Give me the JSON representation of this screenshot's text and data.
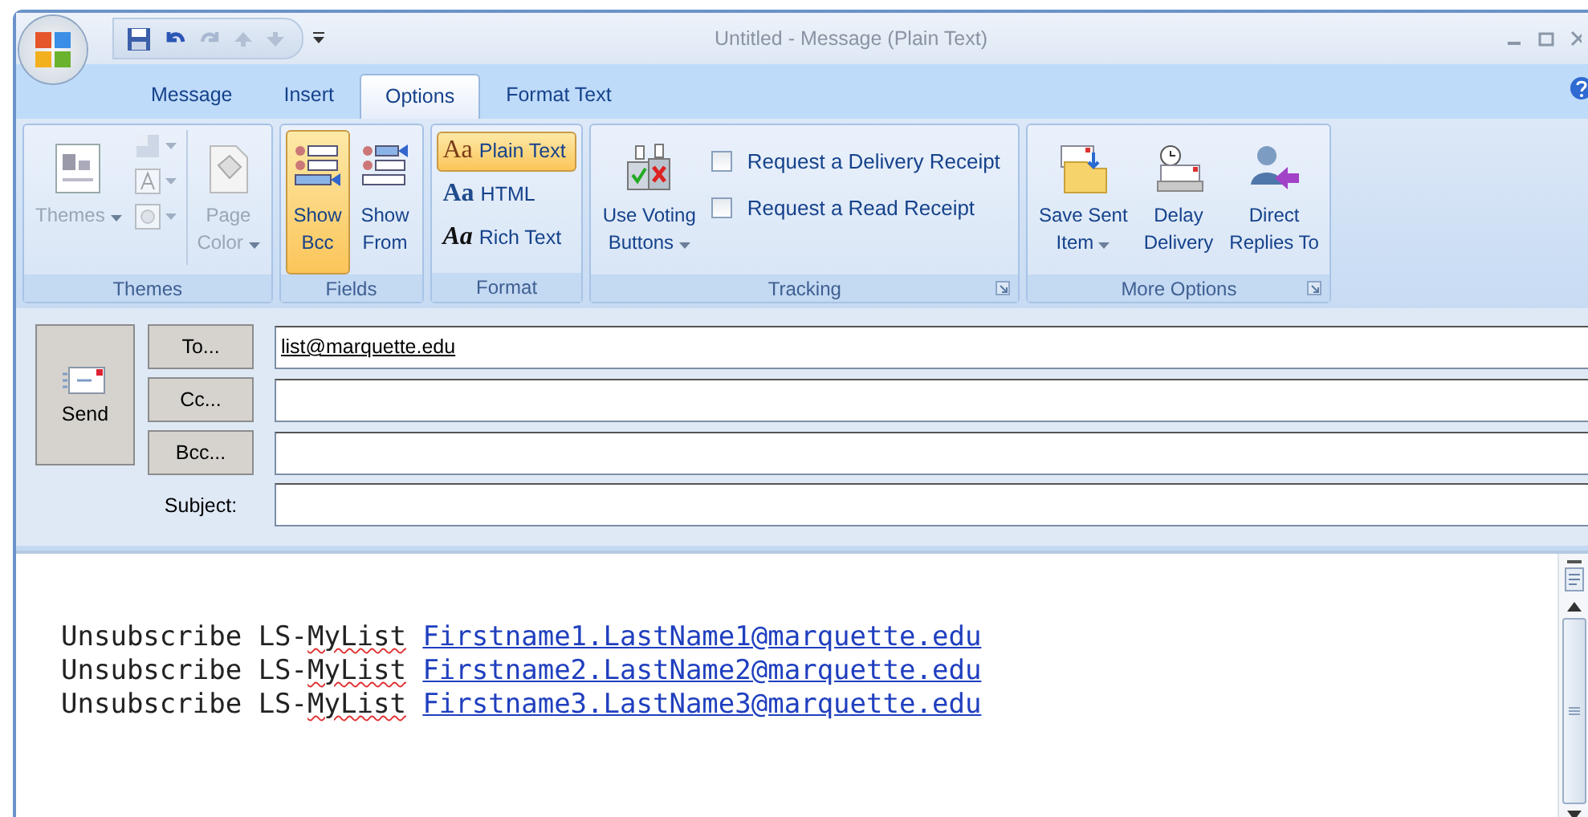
{
  "window": {
    "title": "Untitled - Message (Plain Text)"
  },
  "tabs": [
    {
      "label": "Message",
      "selected": false
    },
    {
      "label": "Insert",
      "selected": false
    },
    {
      "label": "Options",
      "selected": true
    },
    {
      "label": "Format Text",
      "selected": false
    }
  ],
  "ribbon": {
    "groups": [
      {
        "title": "Themes",
        "items": [
          {
            "kind": "large",
            "lines": [
              "Themes"
            ],
            "dropdown": true,
            "disabled": true
          },
          {
            "kind": "stack",
            "children": [
              {
                "dropdown": true,
                "disabled": true
              },
              {
                "dropdown": true,
                "disabled": true
              },
              {
                "dropdown": true,
                "disabled": true
              }
            ]
          },
          {
            "kind": "large",
            "lines": [
              "Page",
              "Color"
            ],
            "dropdown": true,
            "disabled": true
          }
        ]
      },
      {
        "title": "Fields",
        "items": [
          {
            "kind": "large",
            "lines": [
              "Show",
              "Bcc"
            ],
            "selected": true
          },
          {
            "kind": "large",
            "lines": [
              "Show",
              "From"
            ],
            "selected": false
          }
        ]
      },
      {
        "title": "Format",
        "items": [
          {
            "kind": "option",
            "glyph": "Aa",
            "label": "Plain Text",
            "selected": true
          },
          {
            "kind": "option",
            "glyph": "Aa",
            "label": "HTML",
            "selected": false
          },
          {
            "kind": "option",
            "glyph": "Aa",
            "label": "Rich Text",
            "selected": false
          }
        ]
      },
      {
        "title": "Tracking",
        "launcher": true,
        "items": [
          {
            "kind": "large",
            "lines": [
              "Use Voting",
              "Buttons"
            ],
            "dropdown": true
          },
          {
            "kind": "checks",
            "children": [
              {
                "label": "Request a Delivery Receipt",
                "checked": false
              },
              {
                "label": "Request a Read Receipt",
                "checked": false
              }
            ]
          }
        ]
      },
      {
        "title": "More Options",
        "launcher": true,
        "items": [
          {
            "kind": "large",
            "lines": [
              "Save Sent",
              "Item"
            ],
            "dropdown": true
          },
          {
            "kind": "large",
            "lines": [
              "Delay",
              "Delivery"
            ]
          },
          {
            "kind": "large",
            "lines": [
              "Direct",
              "Replies To"
            ]
          }
        ]
      }
    ]
  },
  "header": {
    "send": {
      "label": "Send"
    },
    "fields": [
      {
        "kind": "button",
        "label": "To...",
        "value": "list@marquette.edu"
      },
      {
        "kind": "button",
        "label": "Cc..."
      },
      {
        "kind": "button",
        "label": "Bcc..."
      },
      {
        "kind": "label",
        "label": "Subject:"
      }
    ]
  },
  "body": {
    "lines": [
      {
        "segments": [
          {
            "kind": "plain",
            "text": "Unsubscribe LS-"
          },
          {
            "kind": "misspelled",
            "text": "MyList"
          },
          {
            "kind": "link",
            "text": "Firstname1.LastName1@marquette.edu"
          }
        ]
      },
      {
        "segments": [
          {
            "kind": "plain",
            "text": "Unsubscribe LS-"
          },
          {
            "kind": "misspelled",
            "text": "MyList"
          },
          {
            "kind": "link",
            "text": "Firstname2.LastName2@marquette.edu"
          }
        ]
      },
      {
        "segments": [
          {
            "kind": "plain",
            "text": "Unsubscribe LS-"
          },
          {
            "kind": "misspelled",
            "text": "MyList"
          },
          {
            "kind": "link",
            "text": "Firstname3.LastName3@marquette.edu"
          }
        ]
      }
    ]
  }
}
